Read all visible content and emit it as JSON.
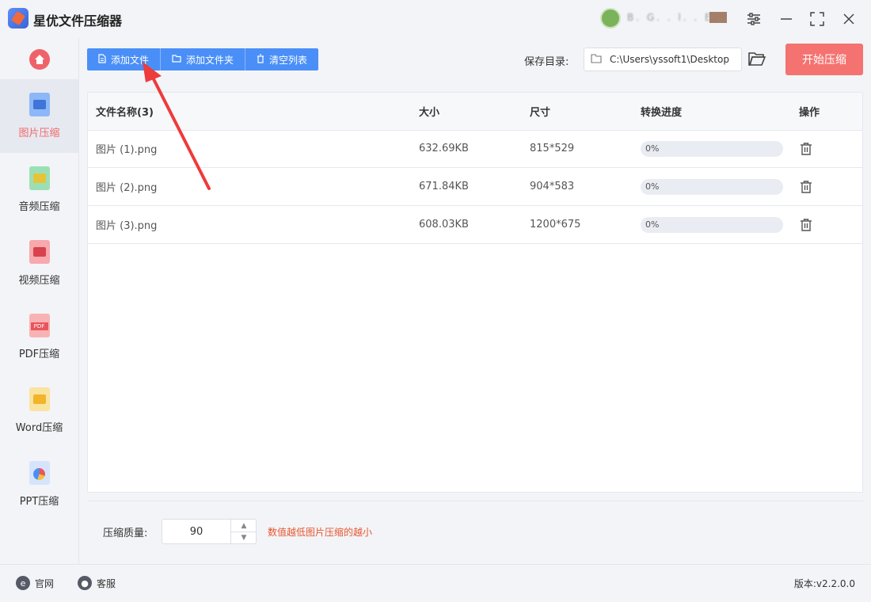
{
  "window": {
    "title": "星优文件压缩器",
    "username": "B. G. . l. . E."
  },
  "sidebar": {
    "items": [
      {
        "label": "图片压缩",
        "icon": "image-file-icon",
        "active": true,
        "color": "#5b9bf5"
      },
      {
        "label": "音频压缩",
        "icon": "audio-file-icon",
        "active": false,
        "color": "#5bc98a"
      },
      {
        "label": "视频压缩",
        "icon": "video-file-icon",
        "active": false,
        "color": "#f0626a"
      },
      {
        "label": "PDF压缩",
        "icon": "pdf-file-icon",
        "active": false,
        "color": "#f06a6a",
        "badge": "PDF"
      },
      {
        "label": "Word压缩",
        "icon": "word-file-icon",
        "active": false,
        "color": "#f3c03c"
      },
      {
        "label": "PPT压缩",
        "icon": "ppt-file-icon",
        "active": false,
        "color": "#5b9bf5"
      }
    ]
  },
  "toolbar": {
    "add_file": "添加文件",
    "add_folder": "添加文件夹",
    "clear_list": "清空列表",
    "save_dir_label": "保存目录:",
    "save_dir_value": "C:\\Users\\yssoft1\\Desktop",
    "start": "开始压缩"
  },
  "table": {
    "headers": {
      "name": "文件名称(3)",
      "size": "大小",
      "dim": "尺寸",
      "progress": "转换进度",
      "op": "操作"
    },
    "rows": [
      {
        "name": "图片 (1).png",
        "size": "632.69KB",
        "dim": "815*529",
        "progress": 0,
        "progress_label": "0%"
      },
      {
        "name": "图片 (2).png",
        "size": "671.84KB",
        "dim": "904*583",
        "progress": 0,
        "progress_label": "0%"
      },
      {
        "name": "图片 (3).png",
        "size": "608.03KB",
        "dim": "1200*675",
        "progress": 0,
        "progress_label": "0%"
      }
    ]
  },
  "settings": {
    "quality_label": "压缩质量:",
    "quality_value": "90",
    "hint": "数值越低图片压缩的越小"
  },
  "footer": {
    "website": "官网",
    "support": "客服",
    "version": "版本:v2.2.0.0"
  },
  "colors": {
    "primary": "#4a8ff7",
    "accent": "#f47370",
    "hint": "#e8552f"
  }
}
